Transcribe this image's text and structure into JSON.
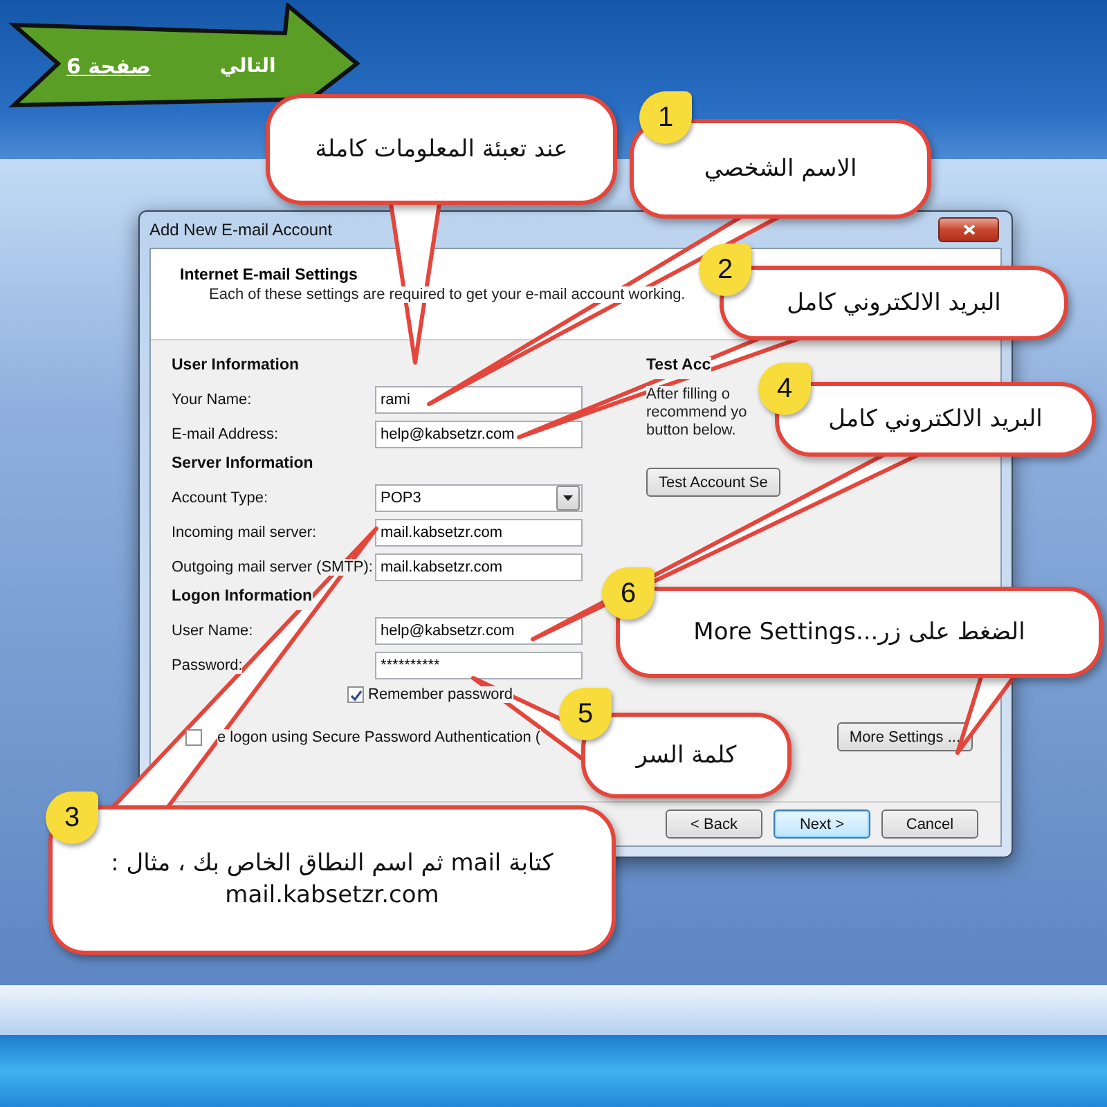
{
  "nav_arrow": {
    "page_link": "صفحة 6",
    "next_label": "التالي"
  },
  "dialog": {
    "title": "Add New E-mail Account",
    "heading": "Internet E-mail Settings",
    "subtitle": "Each of these settings are required to get your e-mail account working.",
    "sections": [
      {
        "heading": "User Information",
        "fields": [
          {
            "label": "Your Name:",
            "value": "rami",
            "kind": "text"
          },
          {
            "label": "E-mail Address:",
            "value": "help@kabsetzr.com",
            "kind": "text"
          }
        ]
      },
      {
        "heading": "Server Information",
        "fields": [
          {
            "label": "Account Type:",
            "value": "POP3",
            "kind": "select"
          },
          {
            "label": "Incoming mail server:",
            "value": "mail.kabsetzr.com",
            "kind": "text"
          },
          {
            "label": "Outgoing mail server (SMTP):",
            "value": "mail.kabsetzr.com",
            "kind": "text"
          }
        ]
      },
      {
        "heading": "Logon Information",
        "fields": [
          {
            "label": "User Name:",
            "value": "help@kabsetzr.com",
            "kind": "text"
          },
          {
            "label": "Password:",
            "value": "**********",
            "kind": "text"
          }
        ]
      }
    ],
    "remember_password": {
      "label": "Remember password",
      "checked": true
    },
    "spa": {
      "label": "e logon using Secure Password Authentication (",
      "checked": false
    },
    "test_panel": {
      "heading": "Test Acc",
      "text": "After filling o\nrecommend yo\nbutton below.",
      "button": "Test Account Se"
    },
    "more_settings": "More Settings ...",
    "buttons": [
      {
        "label": "< Back",
        "selected": false
      },
      {
        "label": "Next >",
        "selected": true
      },
      {
        "label": "Cancel",
        "selected": false
      }
    ]
  },
  "callouts": [
    {
      "badge": "1",
      "text": "الاسم الشخصي"
    },
    {
      "text": "عند تعبئة المعلومات كاملة"
    },
    {
      "badge": "2",
      "text": "البريد الالكتروني كامل"
    },
    {
      "badge": "4",
      "text": "البريد الالكتروني كامل"
    },
    {
      "badge": "6",
      "text": "الضغط على زر...More Settings"
    },
    {
      "badge": "5",
      "text": "كلمة السر"
    },
    {
      "badge": "3",
      "text": "كتابة mail ثم اسم النطاق الخاص بك ، مثال :\nmail.kabsetzr.com"
    }
  ]
}
